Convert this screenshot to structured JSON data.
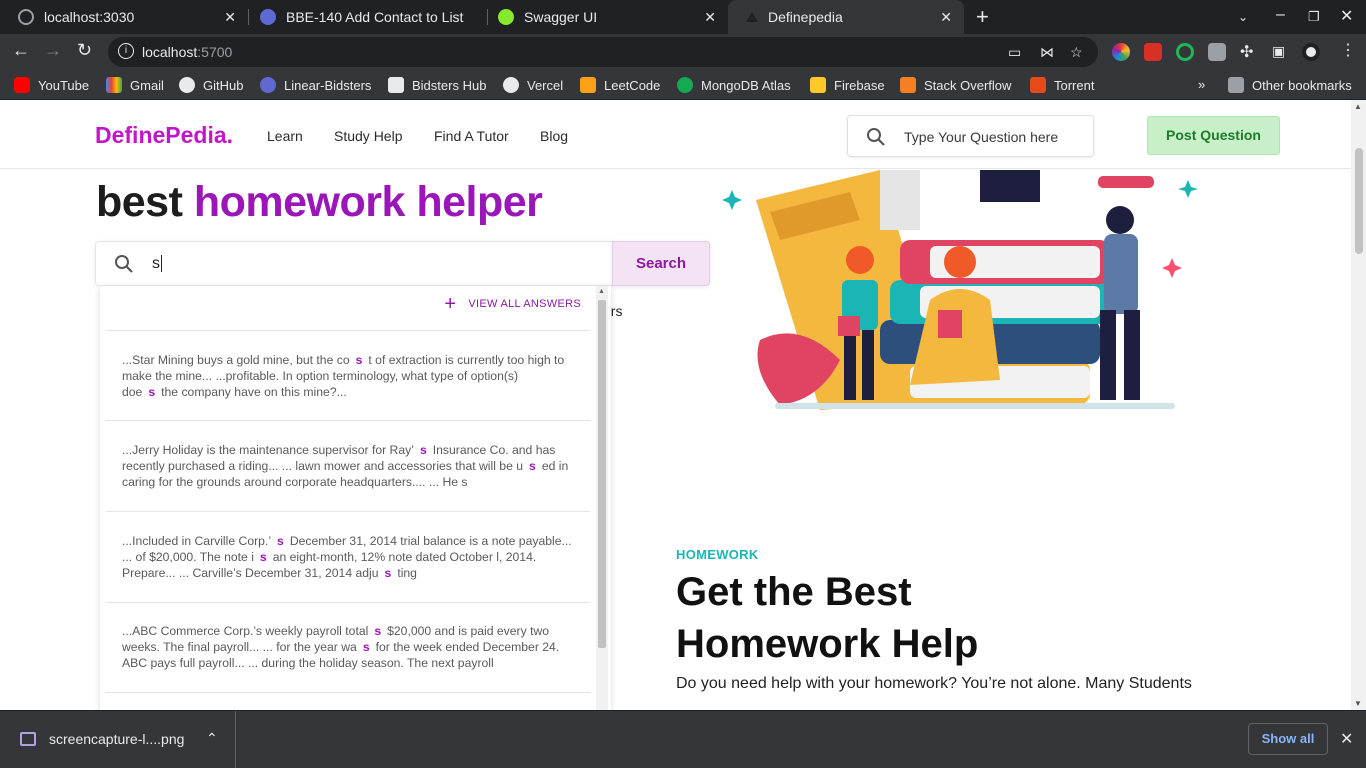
{
  "browser": {
    "tabs": [
      {
        "title": "localhost:3030"
      },
      {
        "title": "BBE-140 Add Contact to List"
      },
      {
        "title": "Swagger UI"
      },
      {
        "title": "Definepedia"
      }
    ],
    "url_host": "localhost",
    "url_port": ":5700",
    "bookmarks": [
      "YouTube",
      "Gmail",
      "GitHub",
      "Linear-Bidsters",
      "Bidsters Hub",
      "Vercel",
      "LeetCode",
      "MongoDB Atlas",
      "Firebase",
      "Stack Overflow",
      "Torrent"
    ],
    "other_bookmarks": "Other bookmarks",
    "download_file": "screencapture-l....png",
    "show_all": "Show all"
  },
  "site": {
    "logo": "DefinePedia.",
    "nav": [
      "Learn",
      "Study Help",
      "Find A Tutor",
      "Blog"
    ],
    "search_placeholder": "Type Your Question here",
    "post_button": "Post Question"
  },
  "hero": {
    "line_start": "best ",
    "line_accent": "homework helper",
    "search_value": "s",
    "search_button": "Search",
    "behind_text": "ors"
  },
  "dropdown": {
    "view_all": "VIEW ALL ANSWERS",
    "results": [
      [
        {
          "t": "...Star Mining buys a gold mine, but the co",
          "h": false
        },
        {
          "t": "s",
          "h": true
        },
        {
          "t": "t of extraction is currently too high to make the mine... ...profitable. In option terminology, what type of option(s) doe",
          "h": false
        },
        {
          "t": "s",
          "h": true
        },
        {
          "t": "the company have on this mine?...",
          "h": false
        }
      ],
      [
        {
          "t": "...Jerry Holiday is the maintenance supervisor for Ray’",
          "h": false
        },
        {
          "t": "s",
          "h": true
        },
        {
          "t": "Insurance Co. and has recently purchased a riding... ... lawn mower and accessories that will be u",
          "h": false
        },
        {
          "t": "s",
          "h": true
        },
        {
          "t": "ed in caring for the grounds around corporate headquarters.... ... He s",
          "h": false
        }
      ],
      [
        {
          "t": "...Included in Carville Corp.’",
          "h": false
        },
        {
          "t": "s",
          "h": true
        },
        {
          "t": "December 31, 2014 trial balance is a note payable... ... of $20,000. The note i",
          "h": false
        },
        {
          "t": "s",
          "h": true
        },
        {
          "t": "an eight-month, 12% note dated October l, 2014. Prepare... ... Carville’s December 31, 2014 adju",
          "h": false
        },
        {
          "t": "s",
          "h": true
        },
        {
          "t": "ting",
          "h": false
        }
      ],
      [
        {
          "t": "...ABC Commerce Corp.’s weekly payroll total",
          "h": false
        },
        {
          "t": "s",
          "h": true
        },
        {
          "t": "$20,000 and is paid every two weeks. The final payroll... ... for the year wa",
          "h": false
        },
        {
          "t": "s",
          "h": true
        },
        {
          "t": "for the week ended December 24. ABC pays full payroll... ... during the holiday season. The next payroll",
          "h": false
        }
      ]
    ]
  },
  "homework": {
    "eyebrow": "HOMEWORK",
    "title": "Get the Best Homework Help",
    "description": "Do you need help with your homework? You’re not alone. Many Students"
  },
  "colors": {
    "brand": "#c315c9",
    "accent": "#9b16b8",
    "teal": "#1bb5b5",
    "post_green": "#c7f0c9"
  }
}
